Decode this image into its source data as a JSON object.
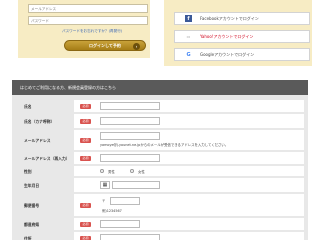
{
  "login": {
    "email_placeholder": "メールアドレス",
    "password_placeholder": "パスワード",
    "forgot_text": "パスワードをお忘れですか？(再発行)",
    "login_button": "ログインして予約",
    "login_chevron": "›"
  },
  "sns": {
    "facebook": "Facebookアカウントでログイン",
    "yahoo": "Yahoo!アカウントでログイン",
    "google": "Googleアカウントでログイン",
    "facebook_icon": "f",
    "google_icon": "G",
    "yahoo_icon": "▭"
  },
  "register": {
    "header": "はじめてご利用になる方、新規会員登録の方はこちら",
    "required_label": "必須",
    "fields": {
      "name": "氏名",
      "kana": "氏名（カナ呼称）",
      "email": "メールアドレス",
      "email_confirm": "メールアドレス（再入力）",
      "gender": "性別",
      "birthday": "生年月日",
      "postal": "郵便番号",
      "prefecture": "都道府県",
      "address": "住所"
    },
    "email_note": "yamoye@j-younet.ne.jpからのメールが受信できるアドレスを入力してください。",
    "gender_options": [
      "男性",
      "女性"
    ],
    "calendar_icon": "▦",
    "postal_mark": "〒",
    "postal_note": "例)1234567"
  },
  "colors": {
    "accent": "#c9a23a",
    "panel_bg": "#f7ecc4",
    "required": "#d9534f",
    "header_bg": "#5a5a5a"
  }
}
